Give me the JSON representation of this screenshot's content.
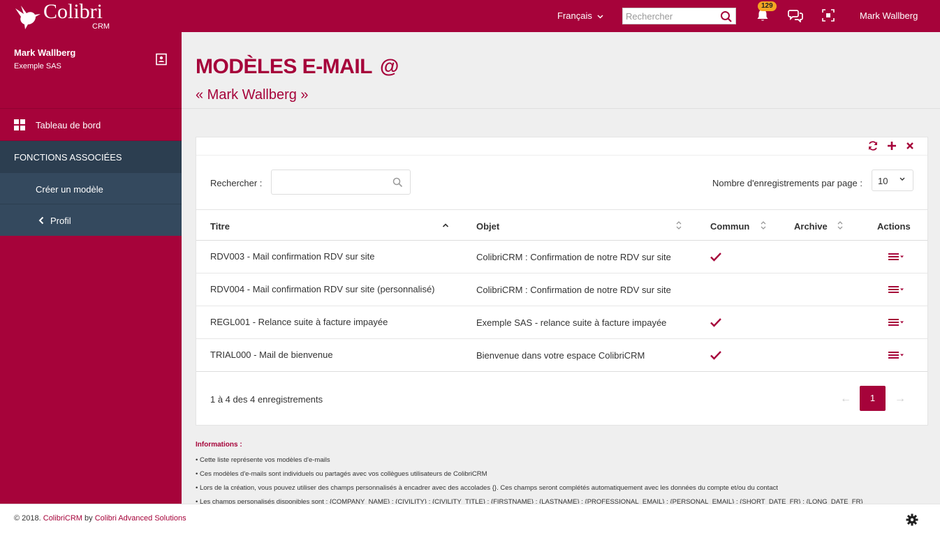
{
  "app": {
    "brand_name": "Colibri",
    "brand_sub": "CRM",
    "accent_color": "#a6033a",
    "sidebar_dark_color": "#2c3e50"
  },
  "topbar": {
    "language": "Français",
    "search_placeholder": "Rechercher",
    "notifications_count": "129",
    "user_name": "Mark Wallberg"
  },
  "sidebar": {
    "user_name": "Mark Wallberg",
    "company": "Exemple SAS",
    "dashboard_label": "Tableau de bord",
    "section_label": "FONCTIONS ASSOCIÉES",
    "create_label": "Créer un modèle",
    "profile_label": "Profil"
  },
  "page": {
    "title": "MODÈLES E-MAIL",
    "title_icon": "@",
    "subtitle": "« Mark Wallberg »"
  },
  "table": {
    "search_label": "Rechercher :",
    "per_page_label": "Nombre d'enregistrements par page :",
    "per_page_value": "10",
    "columns": [
      "Titre",
      "Objet",
      "Commun",
      "Archive",
      "Actions"
    ],
    "rows": [
      {
        "titre": "RDV003 - Mail confirmation RDV sur site",
        "objet": "ColibriCRM : Confirmation de notre RDV sur site",
        "commun": true,
        "archive": false
      },
      {
        "titre": "RDV004 - Mail confirmation RDV sur site (personnalisé)",
        "objet": "ColibriCRM : Confirmation de notre RDV sur site",
        "commun": false,
        "archive": false
      },
      {
        "titre": "REGL001 - Relance suite à facture impayée",
        "objet": "Exemple SAS - relance suite à facture impayée",
        "commun": true,
        "archive": false
      },
      {
        "titre": "TRIAL000 - Mail de bienvenue",
        "objet": "Bienvenue dans votre espace ColibriCRM",
        "commun": true,
        "archive": false
      }
    ],
    "info": "1 à 4 des 4 enregistrements",
    "pagination": {
      "prev": "←",
      "current": "1",
      "next": "→"
    }
  },
  "informations": {
    "title": "Informations :",
    "lines": [
      "• Cette liste représente vos modèles d'e-mails",
      "• Ces modèles d'e-mails sont individuels ou partagés avec vos collègues utilisateurs de ColibriCRM",
      "• Lors de la création, vous pouvez utiliser des champs personnalisés à encadrer avec des accolades {}. Ces champs seront complétés automatiquement avec les données du compte et/ou du contact",
      "• Les champs personalisés disponibles sont : {COMPANY_NAME} ; {CIVILITY} ; {CIVILITY_TITLE} ; {FIRSTNAME} ; {LASTNAME} ; {PROFESSIONAL_EMAIL} ; {PERSONAL_EMAIL} ; {SHORT_DATE_FR} ; {LONG_DATE_FR}"
    ]
  },
  "footer": {
    "prefix": "© 2018. ",
    "product": "ColibriCRM",
    "by": " by ",
    "company": "Colibri Advanced Solutions"
  }
}
